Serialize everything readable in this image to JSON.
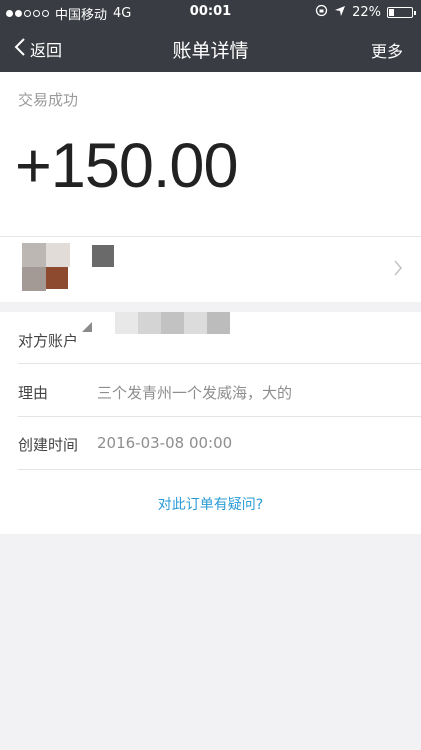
{
  "status_bar": {
    "carrier": "中国移动",
    "network": "4G",
    "time": "00:01",
    "battery": "22%",
    "battery_level": 0.22
  },
  "nav": {
    "back_label": "返回",
    "title": "账单详情",
    "more_label": "更多"
  },
  "transaction": {
    "status": "交易成功",
    "amount": "+150.00"
  },
  "details": {
    "account_label": "对方账户",
    "reason_label": "理由",
    "reason_value": "三个发青州一个发威海，大的",
    "created_label": "创建时间",
    "created_value": "2016-03-08 00:00"
  },
  "question_link": "对此订单有疑问?",
  "colors": {
    "navbar": "#393c42",
    "link": "#2a9bd6",
    "background": "#f2f2f4"
  }
}
